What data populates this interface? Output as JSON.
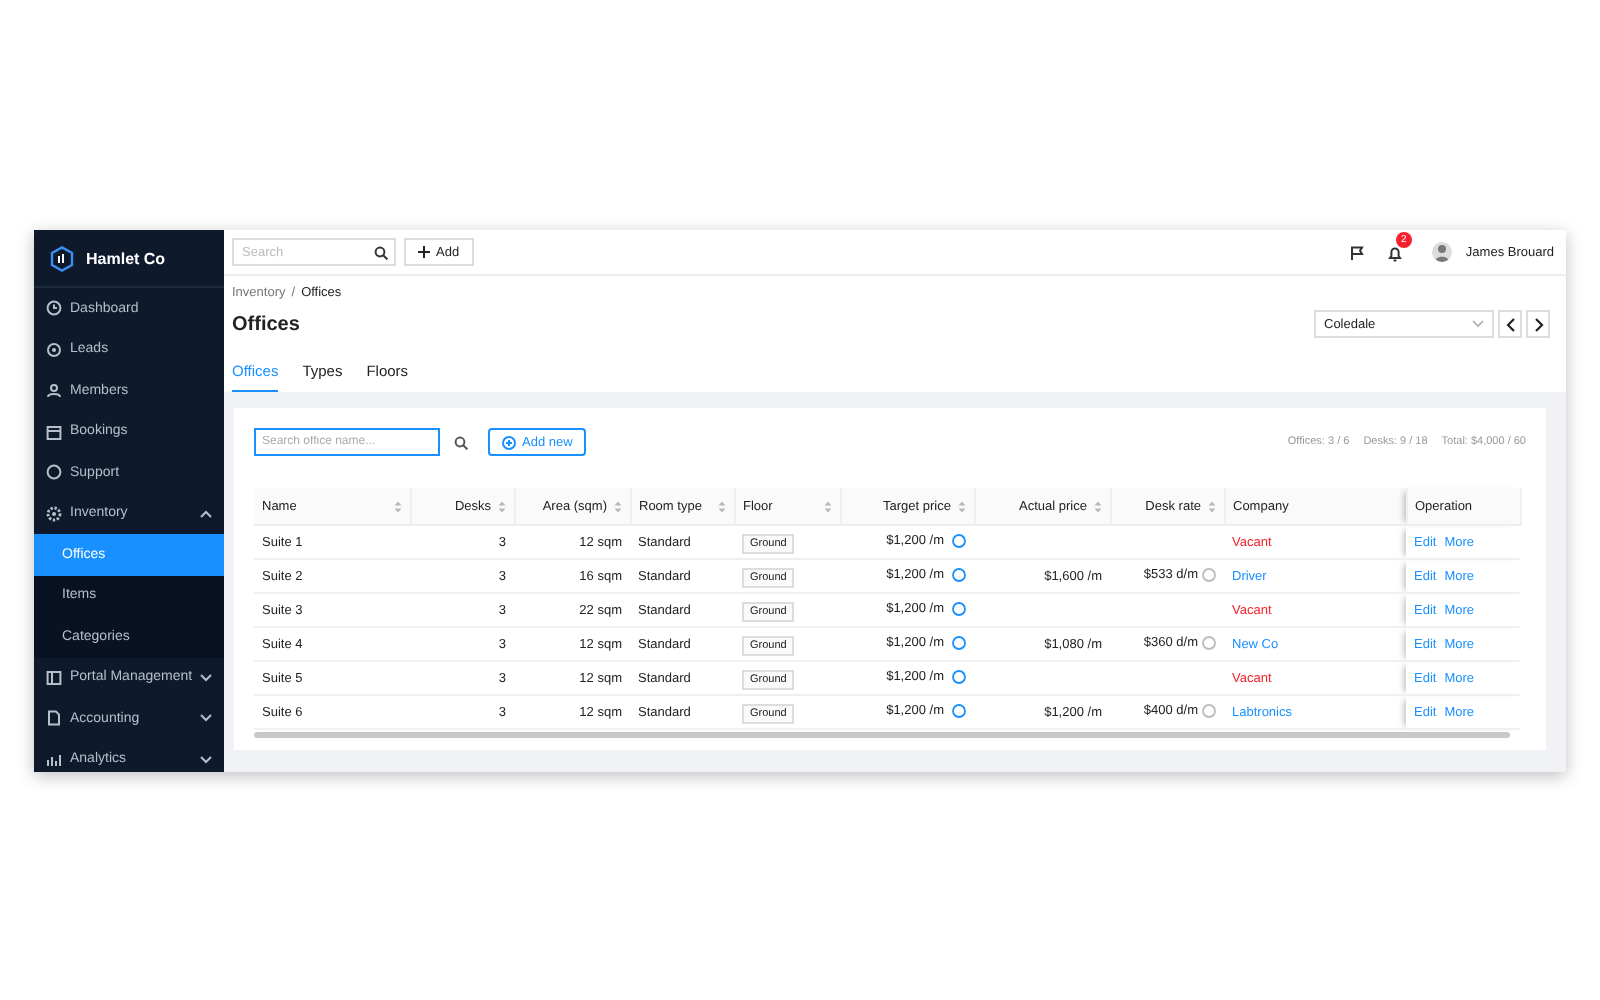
{
  "sidebar": {
    "brand": "Hamlet Co",
    "items": [
      {
        "label": "Dashboard",
        "selected": false
      },
      {
        "label": "Leads",
        "selected": false
      },
      {
        "label": "Members",
        "selected": false
      },
      {
        "label": "Bookings",
        "selected": false
      },
      {
        "label": "Support",
        "selected": false
      },
      {
        "label": "Inventory",
        "selected": false,
        "expanded": true,
        "children": [
          {
            "label": "Offices",
            "selected": true
          },
          {
            "label": "Items",
            "selected": false
          },
          {
            "label": "Categories",
            "selected": false
          }
        ]
      },
      {
        "label": "Portal Management",
        "selected": false,
        "expanded": false
      },
      {
        "label": "Accounting",
        "selected": false,
        "expanded": false
      },
      {
        "label": "Analytics",
        "selected": false,
        "expanded": false
      }
    ]
  },
  "topbar": {
    "search": {
      "placeholder": "Search"
    },
    "add_button": "Add",
    "notification_count": "2",
    "user_name": "James Brouard"
  },
  "breadcrumb": [
    "Inventory",
    "/",
    "Offices"
  ],
  "title": "Offices",
  "location_select": "Coledale",
  "tabs": [
    {
      "label": "Offices",
      "selected": true
    },
    {
      "label": "Types",
      "selected": false
    },
    {
      "label": "Floors",
      "selected": false
    }
  ],
  "toolbar": {
    "search": {
      "placeholder": "Search office name..."
    },
    "add_button": "Add new",
    "stats": [
      "Offices: 3 / 6",
      "Desks: 9 / 18",
      "Total: $4,000 / 60"
    ]
  },
  "table": {
    "columns": [
      {
        "label": "Name",
        "sortable": true
      },
      {
        "label": "Desks",
        "sortable": true
      },
      {
        "label": "Area (sqm)",
        "sortable": true
      },
      {
        "label": "Room type",
        "sortable": true
      },
      {
        "label": "Floor",
        "sortable": true
      },
      {
        "label": "Target price",
        "sortable": true
      },
      {
        "label": "Actual price",
        "sortable": true
      },
      {
        "label": "Desk rate",
        "sortable": true
      },
      {
        "label": "Company",
        "sortable": false
      },
      {
        "label": "Operation",
        "sortable": false
      }
    ],
    "rows": [
      {
        "name": "Suite 1",
        "desks": "3",
        "area": "12 sqm",
        "room_type": "Standard",
        "floor": "Ground",
        "target_price": "$1,200 /m",
        "company": "Vacant",
        "vacant": true,
        "actions": [
          "Edit",
          "More"
        ]
      },
      {
        "name": "Suite 2",
        "desks": "3",
        "area": "16 sqm",
        "room_type": "Standard",
        "floor": "Ground",
        "target_price": "$1,200 /m",
        "actual_price": "$1,600 /m",
        "desk_rate": "$533 d/m",
        "company": "Driver",
        "vacant": false,
        "actions": [
          "Edit",
          "More"
        ]
      },
      {
        "name": "Suite 3",
        "desks": "3",
        "area": "22 sqm",
        "room_type": "Standard",
        "floor": "Ground",
        "target_price": "$1,200 /m",
        "company": "Vacant",
        "vacant": true,
        "actions": [
          "Edit",
          "More"
        ]
      },
      {
        "name": "Suite 4",
        "desks": "3",
        "area": "12 sqm",
        "room_type": "Standard",
        "floor": "Ground",
        "target_price": "$1,200 /m",
        "actual_price": "$1,080 /m",
        "desk_rate": "$360 d/m",
        "company": "New Co",
        "vacant": false,
        "actions": [
          "Edit",
          "More"
        ]
      },
      {
        "name": "Suite 5",
        "desks": "3",
        "area": "12 sqm",
        "room_type": "Standard",
        "floor": "Ground",
        "target_price": "$1,200 /m",
        "company": "Vacant",
        "vacant": true,
        "actions": [
          "Edit",
          "More"
        ]
      },
      {
        "name": "Suite 6",
        "desks": "3",
        "area": "12 sqm",
        "room_type": "Standard",
        "floor": "Ground",
        "target_price": "$1,200 /m",
        "actual_price": "$1,200 /m",
        "desk_rate": "$400 d/m",
        "company": "Labtronics",
        "vacant": false,
        "actions": [
          "Edit",
          "More"
        ]
      }
    ]
  }
}
